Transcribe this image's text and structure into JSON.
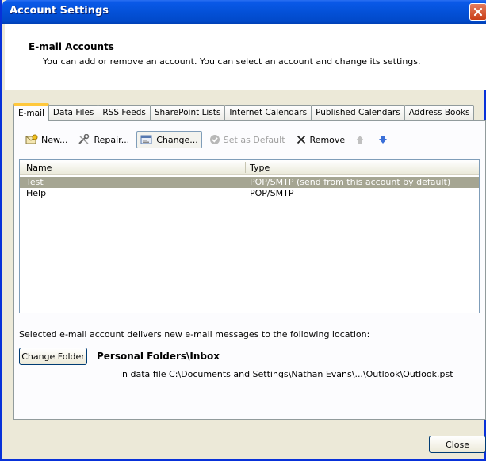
{
  "window": {
    "title": "Account Settings"
  },
  "header": {
    "title": "E-mail Accounts",
    "subtitle": "You can add or remove an account. You can select an account and change its settings."
  },
  "tabs": [
    {
      "label": "E-mail",
      "active": true
    },
    {
      "label": "Data Files"
    },
    {
      "label": "RSS Feeds"
    },
    {
      "label": "SharePoint Lists"
    },
    {
      "label": "Internet Calendars"
    },
    {
      "label": "Published Calendars"
    },
    {
      "label": "Address Books"
    }
  ],
  "toolbar": {
    "new_label": "New...",
    "repair_label": "Repair...",
    "change_label": "Change...",
    "set_default_label": "Set as Default",
    "remove_label": "Remove"
  },
  "accounts_list": {
    "columns": [
      "Name",
      "Type"
    ],
    "rows": [
      {
        "name": "Test",
        "type": "POP/SMTP (send from this account by default)",
        "selected": true
      },
      {
        "name": "Help",
        "type": "POP/SMTP",
        "selected": false
      }
    ]
  },
  "delivery": {
    "label": "Selected e-mail account delivers new e-mail messages to the following location:",
    "change_folder_label": "Change Folder",
    "folder": "Personal Folders\\Inbox",
    "path": "in data file C:\\Documents and Settings\\Nathan Evans\\...\\Outlook\\Outlook.pst"
  },
  "footer": {
    "close_label": "Close"
  },
  "colors": {
    "titlebar": "#0451d8",
    "selection": "#a5a592",
    "tab_highlight": "#ffc83c"
  }
}
